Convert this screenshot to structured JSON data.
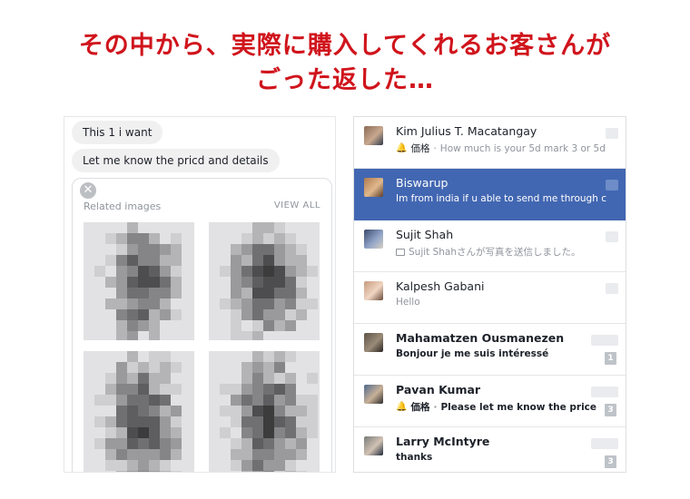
{
  "headline": {
    "line1": "その中から、実際に購入してくれるお客さんが",
    "line2": "ごった返した…"
  },
  "chat": {
    "messages": [
      "This 1 i want",
      "Let me know the pricd and details"
    ],
    "related_label": "Related images",
    "view_all": "VIEW ALL",
    "close_glyph": "✕"
  },
  "inbox": {
    "conversations": [
      {
        "name": "Kim Julius T. Macatangay",
        "has_bell": true,
        "tag": "価格",
        "separator": "·",
        "preview": "How much is your 5d mark 3 or 5d...",
        "selected": false,
        "bold": false,
        "badge": ""
      },
      {
        "name": "Biswarup",
        "has_bell": false,
        "tag": "",
        "separator": "",
        "preview": "Im from india if u able to send me through c...",
        "selected": true,
        "bold": false,
        "badge": ""
      },
      {
        "name": "Sujit Shah",
        "has_bell": false,
        "tag": "",
        "separator": "",
        "preview": "Sujit Shahさんが写真を送信しました。",
        "selected": false,
        "bold": false,
        "badge": "",
        "photo_icon": true
      },
      {
        "name": "Kalpesh Gabani",
        "has_bell": false,
        "tag": "",
        "separator": "",
        "preview": "Hello",
        "selected": false,
        "bold": false,
        "badge": ""
      },
      {
        "name": "Mahamatzen Ousmanezen",
        "has_bell": false,
        "tag": "",
        "separator": "",
        "preview": "Bonjour je me suis intéressé",
        "selected": false,
        "bold": true,
        "badge": "1"
      },
      {
        "name": "Pavan Kumar",
        "has_bell": true,
        "tag": "価格",
        "separator": "·",
        "preview": "Please let me know the price",
        "selected": false,
        "bold": true,
        "badge": "3"
      },
      {
        "name": "Larry McIntyre",
        "has_bell": false,
        "tag": "",
        "separator": "",
        "preview": "thanks",
        "selected": false,
        "bold": true,
        "badge": "3"
      }
    ]
  },
  "colors": {
    "headline": "#d0141c",
    "selected_row": "#4267b2",
    "bubble": "#f1f0f0"
  }
}
